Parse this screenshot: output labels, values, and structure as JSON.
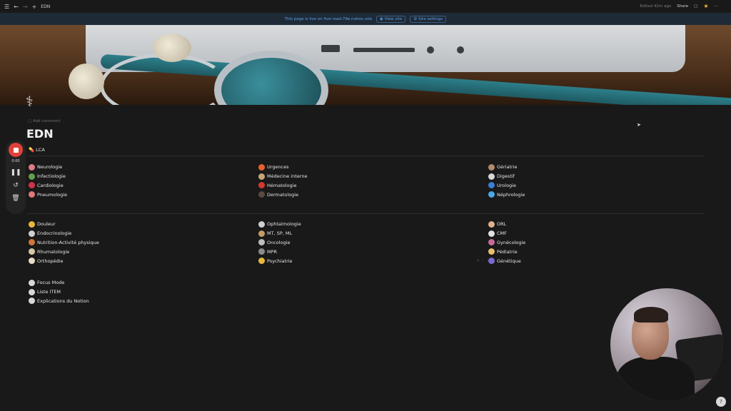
{
  "topbar": {
    "menu_icon": "menu-icon",
    "back_icon": "arrow-left-icon",
    "forward_icon": "arrow-right-icon",
    "add_icon": "plus-icon",
    "page_title": "EDN",
    "edited": "Edited 42m ago",
    "share": "Share",
    "comment_icon": "comment-icon",
    "star_color": "#f2b833"
  },
  "banner": {
    "text": "This page is live on five-road-79e.notion.site",
    "view_site": "View site",
    "site_settings": "Site settings"
  },
  "page": {
    "add_comment": "Add comment",
    "title": "EDN",
    "lca": "LCA"
  },
  "section1": {
    "col1": [
      {
        "label": "Neurologie",
        "icon": "brain-icon",
        "color": "#e07a8c"
      },
      {
        "label": "Infectiologie",
        "icon": "microbe-icon",
        "color": "#5fa04a"
      },
      {
        "label": "Cardiologie",
        "icon": "heart-icon",
        "color": "#d3324a"
      },
      {
        "label": "Pneumologie",
        "icon": "lungs-icon",
        "color": "#e07a7a"
      }
    ],
    "col2": [
      {
        "label": "Urgences",
        "icon": "fire-icon",
        "color": "#e8612c"
      },
      {
        "label": "Médecine interne",
        "icon": "person-icon",
        "color": "#c7a57a"
      },
      {
        "label": "Hématologie",
        "icon": "blood-type-icon",
        "color": "#d6372f"
      },
      {
        "label": "Dermatologie",
        "icon": "skin-icon",
        "color": "#5b4a40"
      }
    ],
    "col3": [
      {
        "label": "Gériatrie",
        "icon": "elder-icon",
        "color": "#b38a6a"
      },
      {
        "label": "Digestif",
        "icon": "stomach-icon",
        "color": "#d8d8d8"
      },
      {
        "label": "Urologie",
        "icon": "wc-icon",
        "color": "#3b7fd6"
      },
      {
        "label": "Néphrologie",
        "icon": "droplet-icon",
        "color": "#4aa8e8"
      }
    ]
  },
  "section2": {
    "col1": [
      {
        "label": "Douleur",
        "icon": "face-icon",
        "color": "#e8b83a"
      },
      {
        "label": "Endocrinologie",
        "icon": "syringe-icon",
        "color": "#cfcfcf"
      },
      {
        "label": "Nutrition-Activité physique",
        "icon": "ball-icon",
        "color": "#d0763a"
      },
      {
        "label": "Rhumatologie",
        "icon": "bone-icon",
        "color": "#d8c8a8"
      },
      {
        "label": "Orthopédie",
        "icon": "bone-icon",
        "color": "#e6dcc8"
      }
    ],
    "col2": [
      {
        "label": "Ophtalmologie",
        "icon": "eye-icon",
        "color": "#cfcfcf"
      },
      {
        "label": "MT, SP, ML",
        "icon": "person-icon",
        "color": "#c89a6a"
      },
      {
        "label": "Oncologie",
        "icon": "cross-icon",
        "color": "#bdbdbd"
      },
      {
        "label": "MPR",
        "icon": "wheelchair-icon",
        "color": "#8a8a8a"
      },
      {
        "label": "Psychiatrie",
        "icon": "face-icon",
        "color": "#e8b83a"
      }
    ],
    "col3": [
      {
        "label": "ORL",
        "icon": "ear-icon",
        "color": "#e0b08a"
      },
      {
        "label": "CMF",
        "icon": "skull-icon",
        "color": "#e0e0e0"
      },
      {
        "label": "Gynécologie",
        "icon": "woman-icon",
        "color": "#c76a9a"
      },
      {
        "label": "Pédiatrie",
        "icon": "baby-icon",
        "color": "#e8c06a"
      },
      {
        "label": "Génétique",
        "icon": "dna-icon",
        "color": "#7a6ad6"
      }
    ]
  },
  "links": [
    {
      "label": "Focus Mode",
      "icon": "timer-icon",
      "color": "#d8d8d8"
    },
    {
      "label": "Liste ITEM",
      "icon": "list-icon",
      "color": "#d8d8d8"
    },
    {
      "label": "Explications du Notion",
      "icon": "building-icon",
      "color": "#d8d8d8"
    }
  ],
  "recorder": {
    "time": "0:00",
    "stop_icon": "stop-icon",
    "pause_icon": "pause-icon",
    "restart_icon": "restart-icon",
    "trash_icon": "trash-icon",
    "accent": "#e0413a"
  }
}
